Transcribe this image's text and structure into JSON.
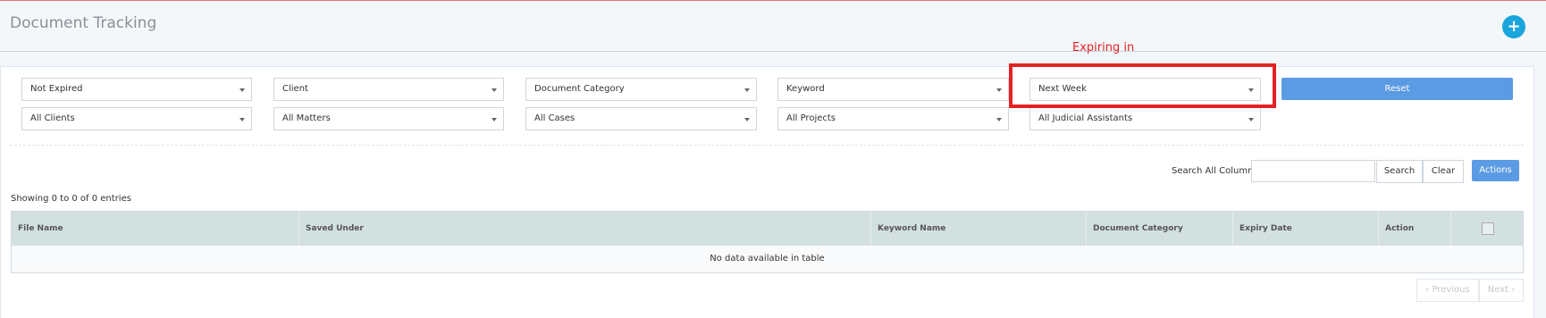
{
  "header": {
    "title": "Document Tracking",
    "add_icon": "+"
  },
  "annotation": {
    "label": "Expiring in"
  },
  "filters": {
    "row1": [
      "Not Expired",
      "Client",
      "Document Category",
      "Keyword",
      "Next Week"
    ],
    "row2": [
      "All Clients",
      "All Matters",
      "All Cases",
      "All Projects",
      "All Judicial Assistants"
    ],
    "reset_label": "Reset"
  },
  "search": {
    "label": "Search All Columns:",
    "value": "",
    "search_label": "Search",
    "clear_label": "Clear",
    "actions_label": "Actions"
  },
  "table": {
    "info": "Showing 0 to 0 of 0 entries",
    "columns": [
      "File Name",
      "Saved Under",
      "Keyword Name",
      "Document Category",
      "Expiry Date",
      "Action"
    ],
    "empty_message": "No data available in table"
  },
  "pagination": {
    "previous": "‹ Previous",
    "next": "Next ›"
  },
  "colors": {
    "accent": "#5b9be3",
    "add_button": "#1aa5dd",
    "highlight": "#e32222",
    "table_header": "#d3e0e0"
  }
}
